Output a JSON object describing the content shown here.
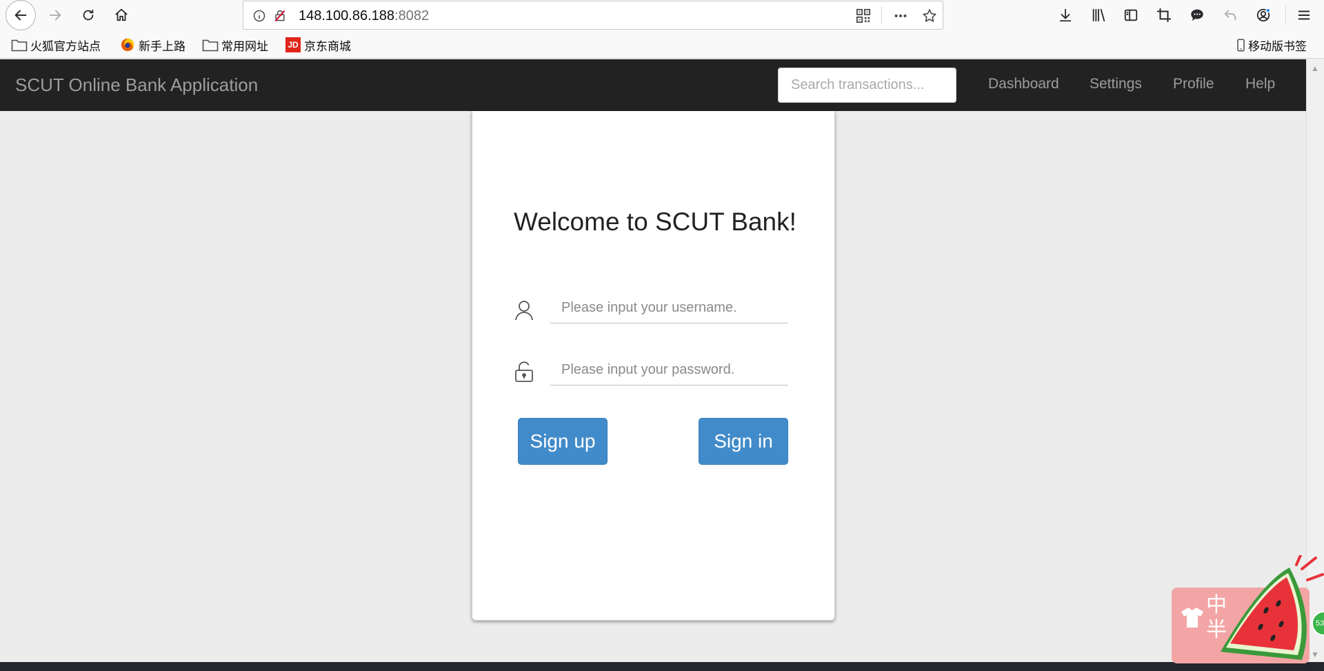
{
  "browser": {
    "url_host": "148.100.86.188",
    "url_port": ":8082",
    "bookmarks": [
      {
        "label": "火狐官方站点",
        "icon": "folder-icon"
      },
      {
        "label": "新手上路",
        "icon": "firefox-icon"
      },
      {
        "label": "常用网址",
        "icon": "folder-icon"
      },
      {
        "label": "京东商城",
        "icon": "jd-icon"
      }
    ],
    "mobile_bookmarks": "移动版书签",
    "jd_logo": "JD"
  },
  "navbar": {
    "brand": "SCUT Online Bank Application",
    "search_placeholder": "Search transactions...",
    "links": [
      "Dashboard",
      "Settings",
      "Profile",
      "Help"
    ]
  },
  "login": {
    "title": "Welcome to SCUT Bank!",
    "username_placeholder": "Please input your username.",
    "password_placeholder": "Please input your password.",
    "signup_label": "Sign up",
    "signin_label": "Sign in"
  },
  "ime": {
    "line1": "中",
    "line2": "半",
    "badge": "53"
  },
  "colors": {
    "navbar_bg": "#222222",
    "button_primary": "#428bca",
    "page_bg": "#ececec"
  }
}
